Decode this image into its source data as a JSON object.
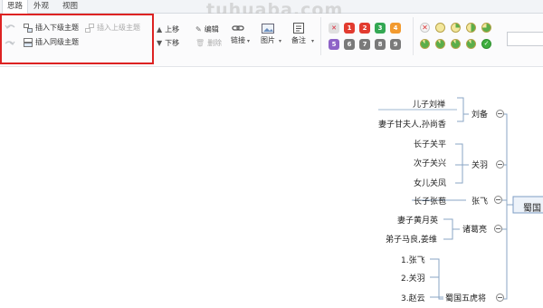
{
  "tabs": [
    "思路",
    "外观",
    "视图"
  ],
  "watermark": "tuhuaba.com",
  "toolbar": {
    "insert_child": "插入下级主题",
    "insert_parent": "插入上级主题",
    "insert_sibling": "插入同级主题",
    "move_up": "上移",
    "move_down": "下移",
    "edit": "编辑",
    "delete": "删除",
    "link": "链接",
    "image": "图片",
    "note": "备注"
  },
  "priority_badges": [
    {
      "label": "✕",
      "color": "#e0e0e0",
      "text_color": "#d23"
    },
    {
      "label": "1",
      "color": "#e23b2f"
    },
    {
      "label": "2",
      "color": "#e23b2f"
    },
    {
      "label": "3",
      "color": "#34a853"
    },
    {
      "label": "4",
      "color": "#f29a2e"
    },
    {
      "label": "5",
      "color": "#8e63c7"
    },
    {
      "label": "6",
      "color": "#7a7a7a"
    },
    {
      "label": "7",
      "color": "#7a7a7a"
    },
    {
      "label": "8",
      "color": "#7a7a7a"
    },
    {
      "label": "9",
      "color": "#7a7a7a"
    }
  ],
  "mindmap": {
    "root": "蜀国",
    "branches": [
      {
        "label": "刘备",
        "children": [
          "儿子刘禅",
          "妻子甘夫人,孙尚香"
        ]
      },
      {
        "label": "关羽",
        "children": [
          "长子关平",
          "次子关兴",
          "女儿关凤"
        ]
      },
      {
        "label": "张飞",
        "children": [
          "长子张苞"
        ]
      },
      {
        "label": "诸葛亮",
        "children": [
          "妻子黄月英",
          "弟子马良,姜维"
        ]
      },
      {
        "label": "蜀国五虎将",
        "children": [
          "1.张飞",
          "2.关羽",
          "3.赵云"
        ]
      }
    ]
  }
}
